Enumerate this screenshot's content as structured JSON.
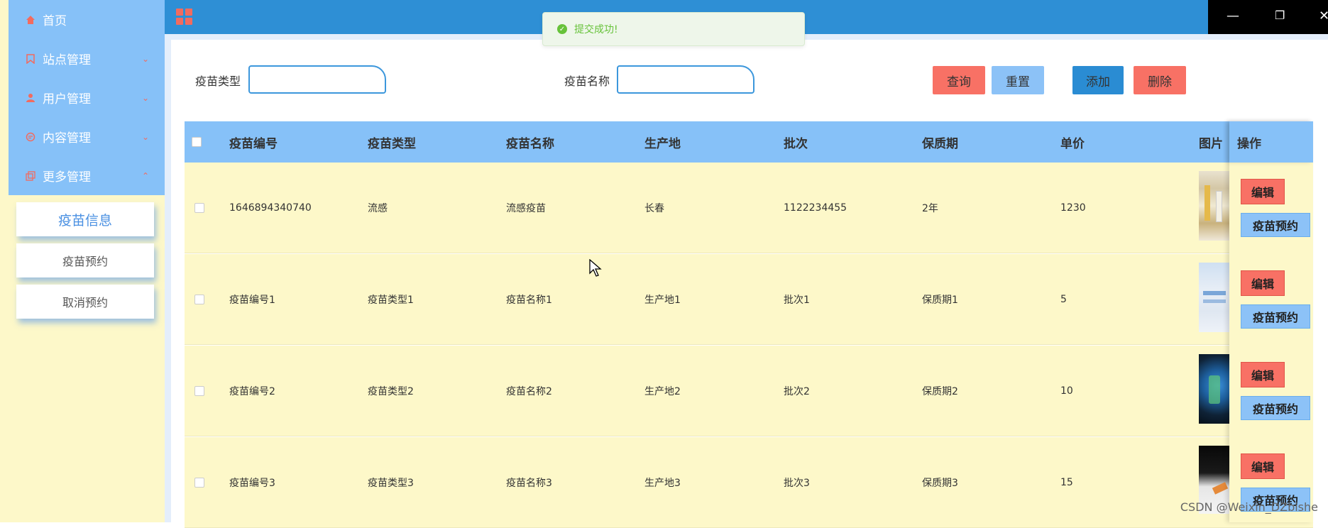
{
  "sidebar": {
    "items": [
      {
        "label": "首页",
        "icon": "home-icon",
        "arrow": ""
      },
      {
        "label": "站点管理",
        "icon": "site-icon",
        "arrow": "chevron-down-icon"
      },
      {
        "label": "用户管理",
        "icon": "user-icon",
        "arrow": "chevron-down-icon"
      },
      {
        "label": "内容管理",
        "icon": "content-icon",
        "arrow": "chevron-down-icon"
      },
      {
        "label": "更多管理",
        "icon": "more-icon",
        "arrow": "chevron-up-icon"
      }
    ],
    "submenu": [
      {
        "label": "疫苗信息",
        "active": true
      },
      {
        "label": "疫苗预约",
        "active": false
      },
      {
        "label": "取消预约",
        "active": false
      }
    ]
  },
  "toast": {
    "text": "提交成功!"
  },
  "search": {
    "type_label": "疫苗类型",
    "type_value": "",
    "name_label": "疫苗名称",
    "name_value": ""
  },
  "buttons": {
    "query": "查询",
    "reset": "重置",
    "add": "添加",
    "delete": "删除"
  },
  "table": {
    "headers": [
      "疫苗编号",
      "疫苗类型",
      "疫苗名称",
      "生产地",
      "批次",
      "保质期",
      "单价",
      "图片",
      "操作"
    ],
    "rows": [
      [
        "1646894340740",
        "流感",
        "流感疫苗",
        "长春",
        "1122234455",
        "2年",
        "1230"
      ],
      [
        "疫苗编号1",
        "疫苗类型1",
        "疫苗名称1",
        "生产地1",
        "批次1",
        "保质期1",
        "5"
      ],
      [
        "疫苗编号2",
        "疫苗类型2",
        "疫苗名称2",
        "生产地2",
        "批次2",
        "保质期2",
        "10"
      ],
      [
        "疫苗编号3",
        "疫苗类型3",
        "疫苗名称3",
        "生产地3",
        "批次3",
        "保质期3",
        "15"
      ]
    ],
    "edit_label": "编辑",
    "book_label": "疫苗预约"
  },
  "watermark": "CSDN @Weixin_DZbishe",
  "colors": {
    "header_blue": "#2e8fd5",
    "menu_blue": "#86c1f8",
    "row_yellow": "#fdf8c9",
    "accent_red": "#f87165"
  }
}
